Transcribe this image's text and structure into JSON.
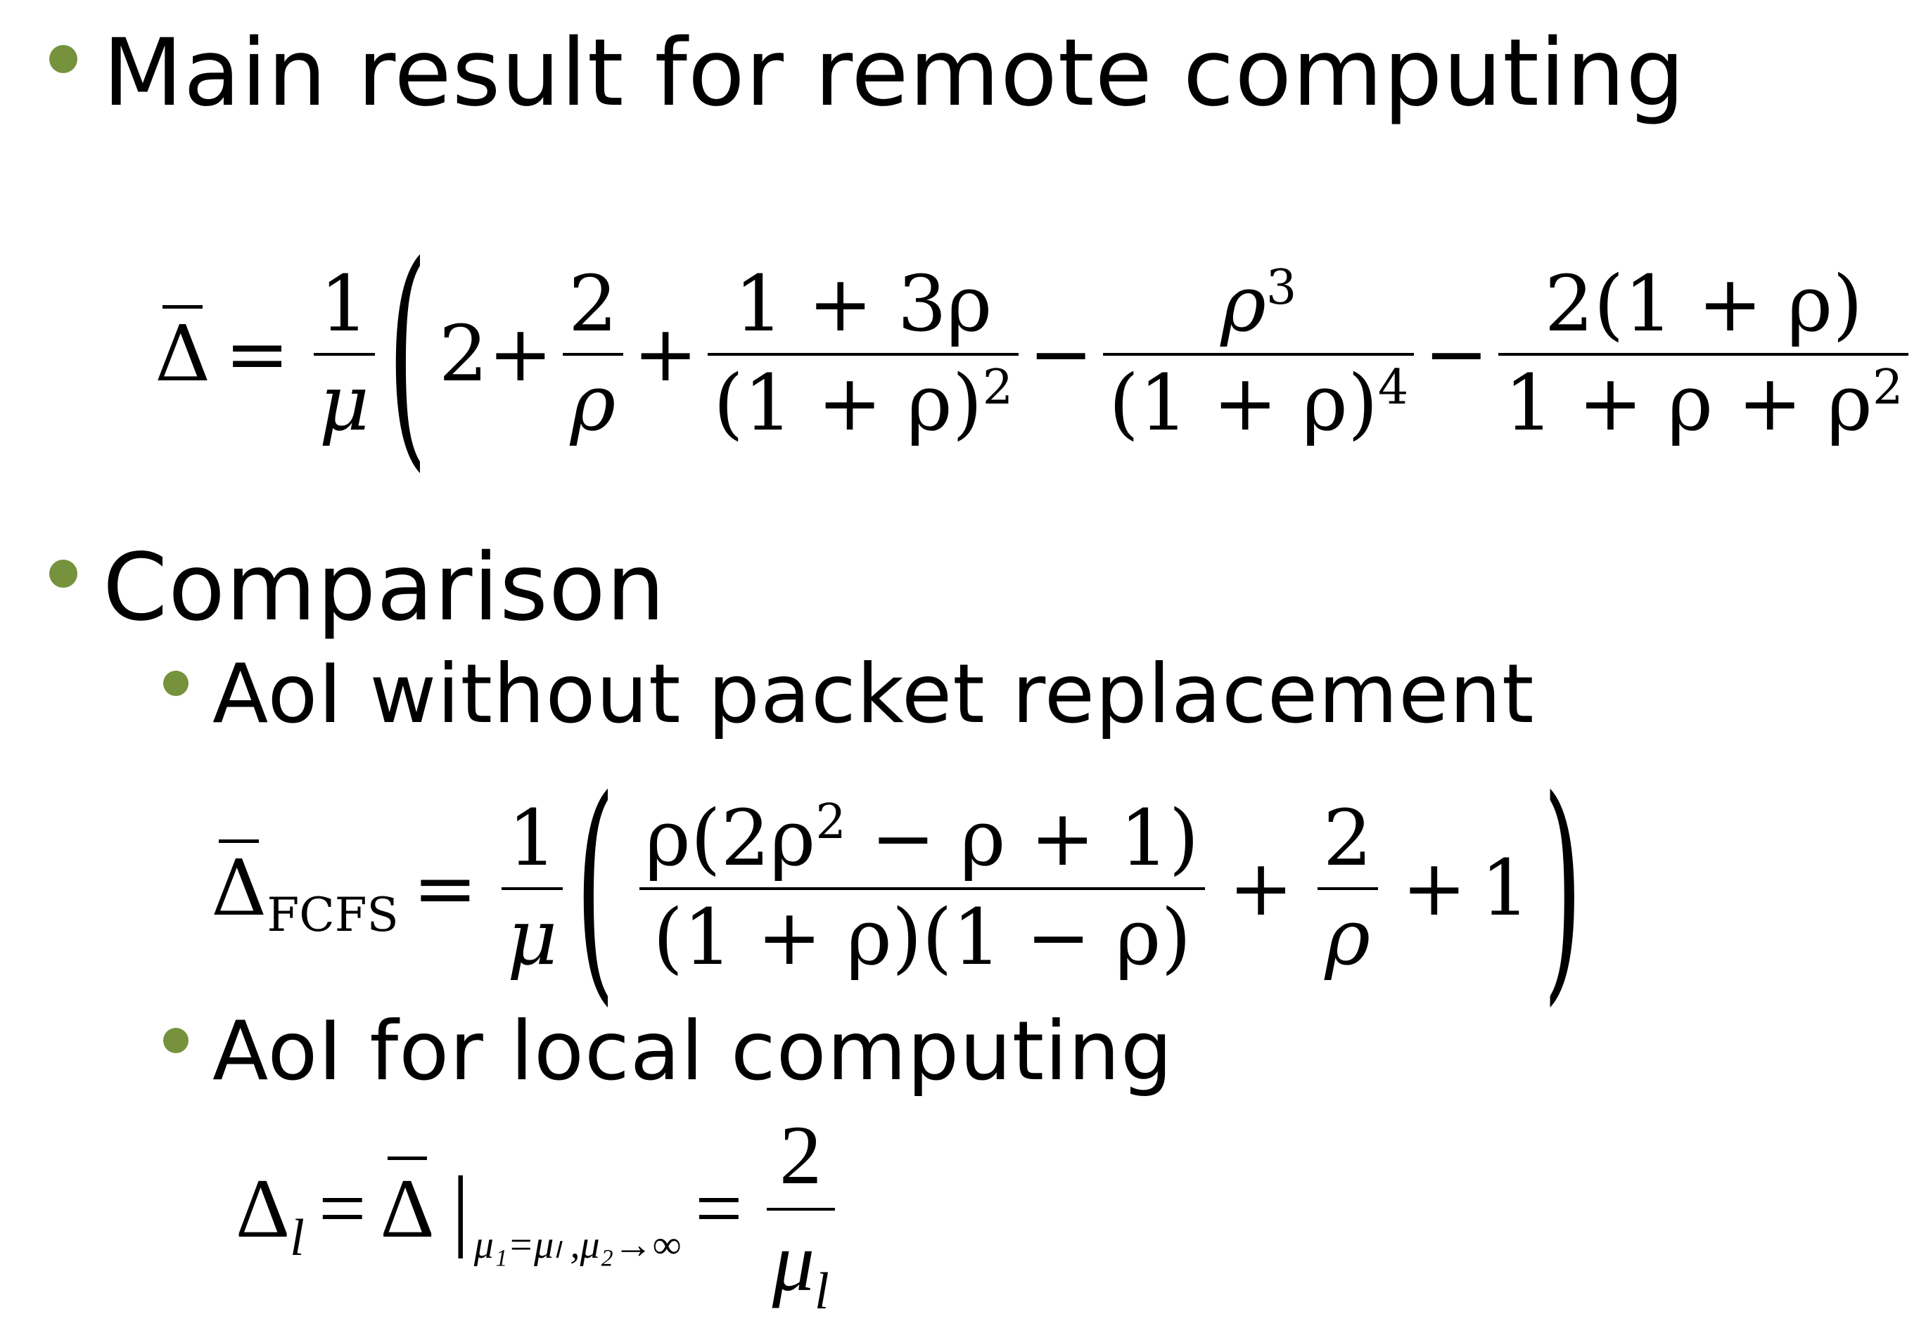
{
  "bullets": {
    "main_result": "Main result for remote computing",
    "comparison": "Comparison",
    "aoi_without": "AoI without packet replacement",
    "aoi_local": "AoI for local computing"
  },
  "eq1": {
    "lhs": "Δ",
    "equals": "=",
    "coef_num": "1",
    "coef_den": "μ",
    "lparen": "(",
    "t1": "2",
    "plus1": "+",
    "f1_num": "2",
    "f1_den": "ρ",
    "plus2": "+",
    "f2_num": "1 + 3ρ",
    "f2_den": "(1 + ρ)",
    "f2_den_exp": "2",
    "minus1": "−",
    "f3_num": "ρ",
    "f3_num_exp": "3",
    "f3_den": "(1 + ρ)",
    "f3_den_exp": "4",
    "minus2": "−",
    "f4_num": "2(1 + ρ)",
    "f4_den": "1 + ρ + ρ",
    "f4_den_exp": "2",
    "rparen": ")"
  },
  "eq2": {
    "lhs": "Δ",
    "lhs_sub": "FCFS",
    "equals": "=",
    "coef_num": "1",
    "coef_den": "μ",
    "lparen": "(",
    "f1_num_a": "ρ(2ρ",
    "f1_num_exp": "2",
    "f1_num_b": " − ρ + 1)",
    "f1_den": "(1 + ρ)(1 − ρ)",
    "plus1": "+",
    "f2_num": "2",
    "f2_den": "ρ",
    "plus2": "+",
    "t3": "1",
    "rparen": ")"
  },
  "eq3": {
    "lhs": "Δ",
    "lhs_sub": "l",
    "equals1": "=",
    "mid": "Δ",
    "bar_sep": "|",
    "cond": "μ₁=μₗ ,μ₂→∞",
    "equals2": "=",
    "f_num": "2",
    "f_den": "μ",
    "f_den_sub": "l"
  }
}
